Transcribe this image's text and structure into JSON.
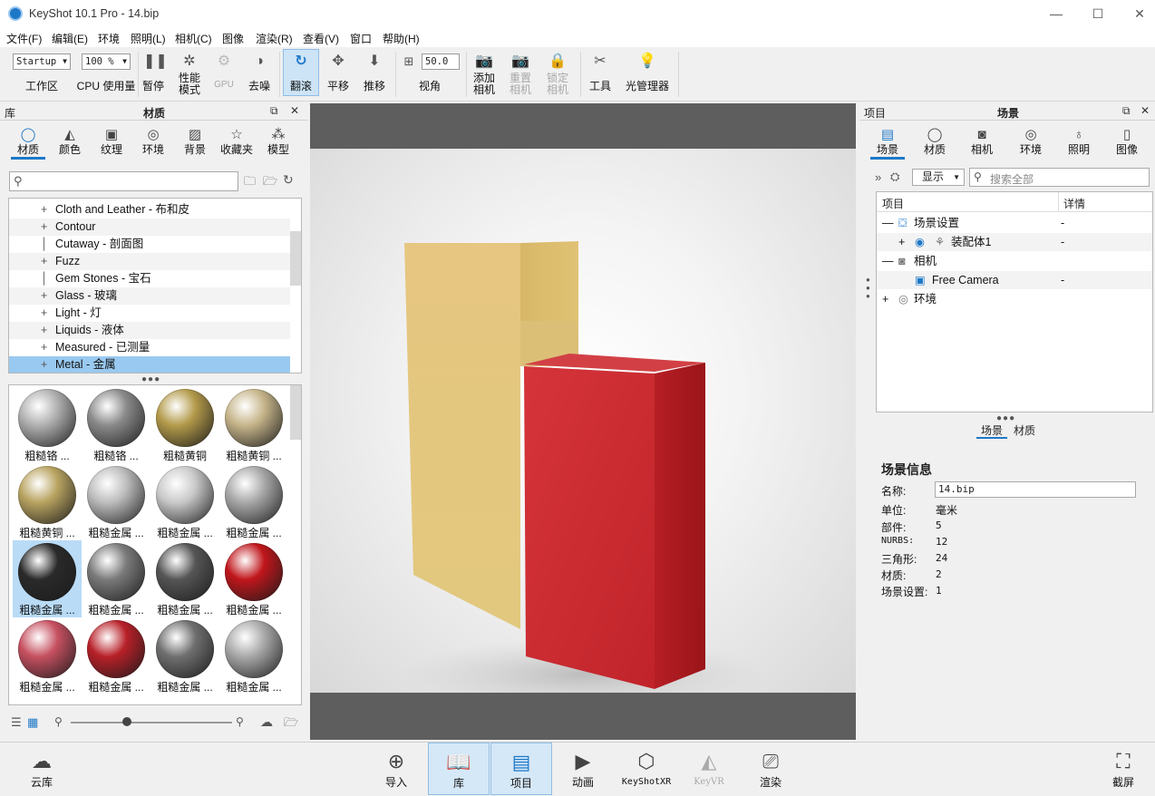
{
  "window": {
    "title": "KeyShot 10.1 Pro  -  14.bip"
  },
  "menu": [
    "文件(F)",
    "编辑(E)",
    "环境",
    "照明(L)",
    "相机(C)",
    "图像",
    "渲染(R)",
    "查看(V)",
    "窗口",
    "帮助(H)"
  ],
  "toolbar": {
    "workspace_value": "Startup",
    "workspace_label": "工作区",
    "cpu_value": "100 %",
    "cpu_label": "CPU 使用量",
    "pause": "暂停",
    "perf_mode": "性能\n模式",
    "gpu": "GPU",
    "denoise": "去噪",
    "tumble": "翻滚",
    "pan": "平移",
    "dolly": "推移",
    "fov_value": "50.0",
    "fov_label": "视角",
    "add_camera": "添加\n相机",
    "reset_camera": "重置\n相机",
    "lock_camera": "锁定\n相机",
    "tools": "工具",
    "light_manager": "光管理器"
  },
  "library": {
    "header_left": "库",
    "title": "材质",
    "tabs": [
      "材质",
      "颜色",
      "纹理",
      "环境",
      "背景",
      "收藏夹",
      "模型"
    ],
    "active_tab": "材质",
    "tree": [
      {
        "label": "Cloth and Leather - 布和皮",
        "expandable": true
      },
      {
        "label": "Contour",
        "expandable": true
      },
      {
        "label": "Cutaway - 剖面图",
        "expandable": false
      },
      {
        "label": "Fuzz",
        "expandable": true
      },
      {
        "label": "Gem Stones - 宝石",
        "expandable": false
      },
      {
        "label": "Glass - 玻璃",
        "expandable": true
      },
      {
        "label": "Light - 灯",
        "expandable": true
      },
      {
        "label": "Liquids - 液体",
        "expandable": true
      },
      {
        "label": "Measured - 已测量",
        "expandable": true
      },
      {
        "label": "Metal - 金属",
        "expandable": true,
        "selected": true
      }
    ],
    "thumbnails": [
      {
        "label": "粗糙铬 ...",
        "color": "#b0b0b0"
      },
      {
        "label": "粗糙铬 ...",
        "color": "#8a8a8a"
      },
      {
        "label": "粗糙黄铜",
        "color": "#b39a4a"
      },
      {
        "label": "粗糙黄铜 ...",
        "color": "#c6b58a"
      },
      {
        "label": "粗糙黄铜 ...",
        "color": "#b8a360"
      },
      {
        "label": "粗糙金属 ...",
        "color": "#bdbdbd"
      },
      {
        "label": "粗糙金属 ...",
        "color": "#c9c9c9"
      },
      {
        "label": "粗糙金属 ...",
        "color": "#a8a8a8"
      },
      {
        "label": "粗糙金属 ...",
        "color": "#2a2a2a",
        "selected": true
      },
      {
        "label": "粗糙金属 ...",
        "color": "#7a7a7a"
      },
      {
        "label": "粗糙金属 ...",
        "color": "#555555"
      },
      {
        "label": "粗糙金属 ...",
        "color": "#c0161b"
      },
      {
        "label": "粗糙金属 ...",
        "color": "#c65060"
      },
      {
        "label": "粗糙金属 ...",
        "color": "#b82028"
      },
      {
        "label": "粗糙金属 ...",
        "color": "#6f6f6f"
      },
      {
        "label": "粗糙金属 ...",
        "color": "#a9a9a9"
      }
    ]
  },
  "project": {
    "header_left": "项目",
    "title": "场景",
    "tabs": [
      "场景",
      "材质",
      "相机",
      "环境",
      "照明",
      "图像"
    ],
    "active_tab": "场景",
    "display_value": "显示",
    "search_placeholder": "搜索全部",
    "col_item": "项目",
    "col_detail": "详情",
    "tree": [
      {
        "label": "场景设置",
        "detail": "-"
      },
      {
        "label": "装配体1",
        "detail": "-"
      },
      {
        "label": "相机",
        "detail": ""
      },
      {
        "label": "Free Camera",
        "detail": "-"
      },
      {
        "label": "环境",
        "detail": ""
      }
    ],
    "subtabs": [
      "场景",
      "材质"
    ],
    "info_title": "场景信息",
    "info": [
      {
        "k": "名称:",
        "v": "14.bip"
      },
      {
        "k": "单位:",
        "v": "毫米"
      },
      {
        "k": "部件:",
        "v": "5"
      },
      {
        "k": "NURBS:",
        "v": "12"
      },
      {
        "k": "三角形:",
        "v": "24"
      },
      {
        "k": "材质:",
        "v": "2"
      },
      {
        "k": "场景设置:",
        "v": "1"
      }
    ]
  },
  "bottom": {
    "cloud": "云库",
    "import": "导入",
    "library": "库",
    "project": "项目",
    "animation": "动画",
    "keyshotxr": "KeyShotXR",
    "keyvr": "KeyVR",
    "render": "渲染",
    "screenshot": "截屏"
  },
  "colors": {
    "accent": "#1e78c8",
    "yellow_box": "#e4c57a",
    "red_box": "#c8262b"
  }
}
